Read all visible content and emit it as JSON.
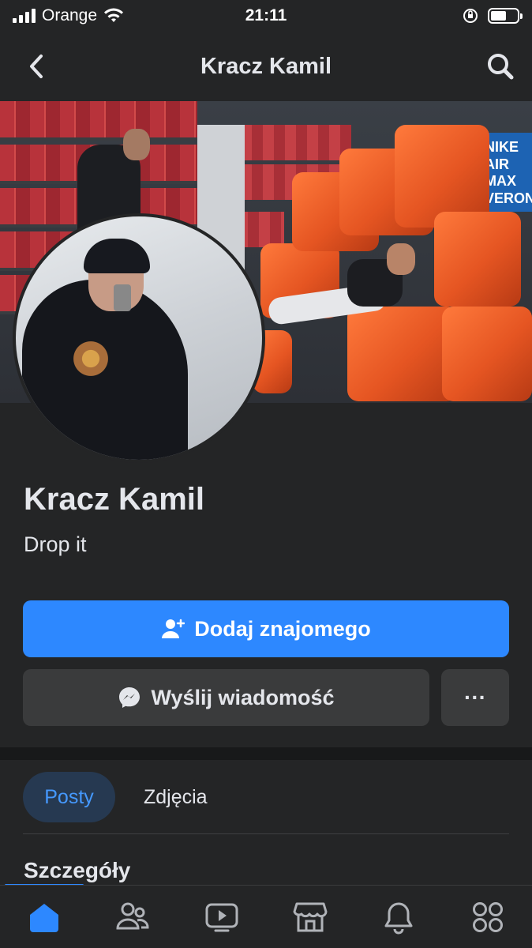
{
  "status_bar": {
    "carrier": "Orange",
    "time": "21:11"
  },
  "header": {
    "title": "Kracz Kamil",
    "back_icon": "chevron-left-icon",
    "search_icon": "search-icon"
  },
  "profile": {
    "name": "Kracz Kamil",
    "bio": "Drop it",
    "cover_banner_text": "NIKE AIR MAX VERONA"
  },
  "actions": {
    "add_friend_label": "Dodaj znajomego",
    "message_label": "Wyślij wiadomość",
    "more_label": "···"
  },
  "tabs": [
    {
      "label": "Posty",
      "active": true
    },
    {
      "label": "Zdjęcia",
      "active": false
    }
  ],
  "section": {
    "title": "Szczegóły"
  },
  "bottom_nav": [
    {
      "icon": "home-icon",
      "active": true
    },
    {
      "icon": "friends-icon",
      "active": false
    },
    {
      "icon": "watch-icon",
      "active": false
    },
    {
      "icon": "marketplace-icon",
      "active": false
    },
    {
      "icon": "bell-icon",
      "active": false
    },
    {
      "icon": "menu-grid-icon",
      "active": false
    }
  ],
  "colors": {
    "background": "#242526",
    "primary": "#2d88ff",
    "secondary_button": "#3a3b3c",
    "active_tab_bg": "#263951",
    "text": "#e4e6eb"
  }
}
